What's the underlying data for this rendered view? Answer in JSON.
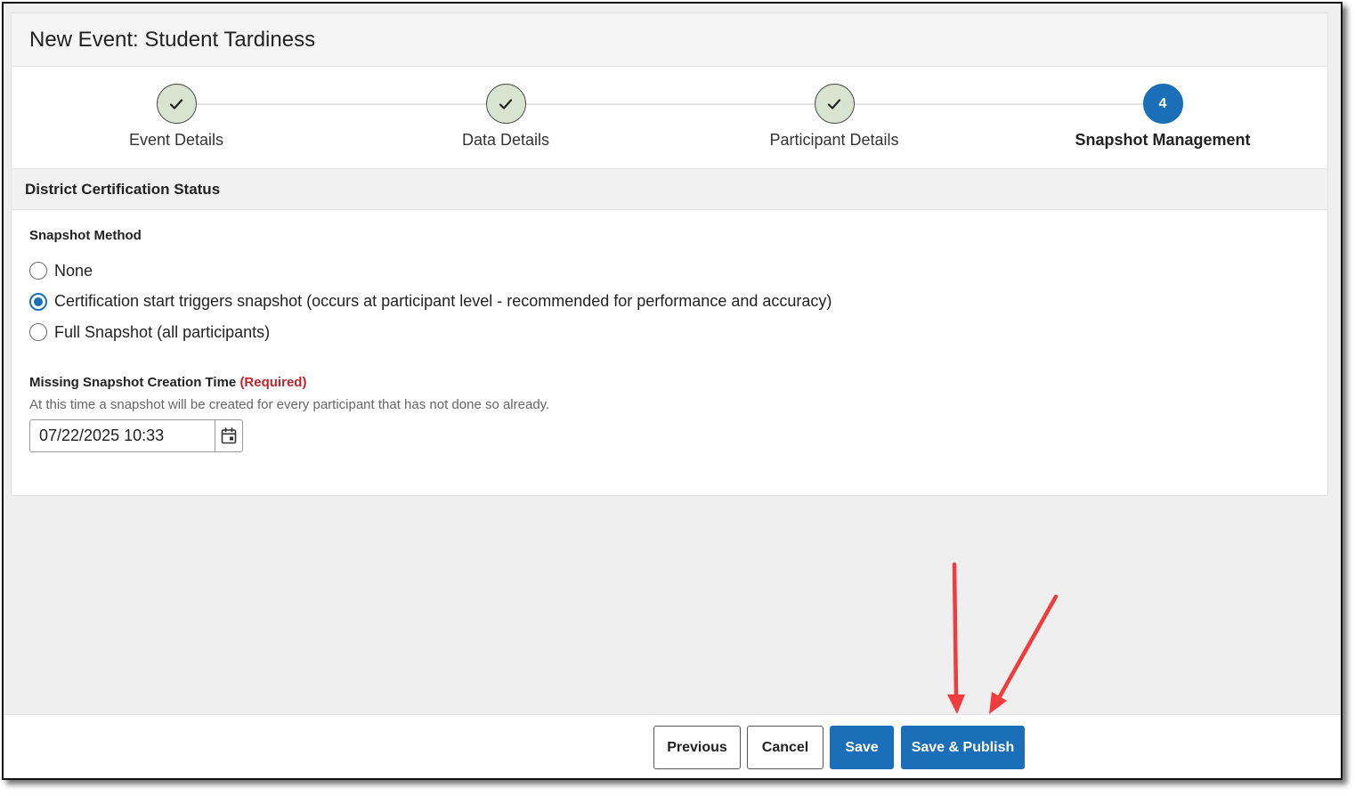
{
  "header": {
    "title": "New Event: Student Tardiness"
  },
  "stepper": {
    "steps": [
      {
        "label": "Event Details",
        "state": "complete",
        "icon": "check-icon"
      },
      {
        "label": "Data Details",
        "state": "complete",
        "icon": "check-icon"
      },
      {
        "label": "Participant Details",
        "state": "complete",
        "icon": "check-icon"
      },
      {
        "label": "Snapshot Management",
        "state": "active",
        "number": "4"
      }
    ]
  },
  "section": {
    "title": "District Certification Status"
  },
  "snapshot_method": {
    "label": "Snapshot Method",
    "options": [
      {
        "label": "None",
        "checked": false
      },
      {
        "label": "Certification start triggers snapshot (occurs at participant level - recommended for performance and accuracy)",
        "checked": true
      },
      {
        "label": "Full Snapshot (all participants)",
        "checked": false
      }
    ]
  },
  "missing_snapshot": {
    "label": "Missing Snapshot Creation Time",
    "required_text": "(Required)",
    "help": "At this time a snapshot will be created for every participant that has not done so already.",
    "value": "07/22/2025 10:33",
    "icon": "calendar-icon"
  },
  "footer": {
    "previous_label": "Previous",
    "cancel_label": "Cancel",
    "save_label": "Save",
    "save_publish_label": "Save & Publish"
  },
  "colors": {
    "primary": "#1a6fb8",
    "complete_step": "#d8e4cf",
    "required": "#c0242b",
    "annotation_arrow": "#f03c3c"
  }
}
